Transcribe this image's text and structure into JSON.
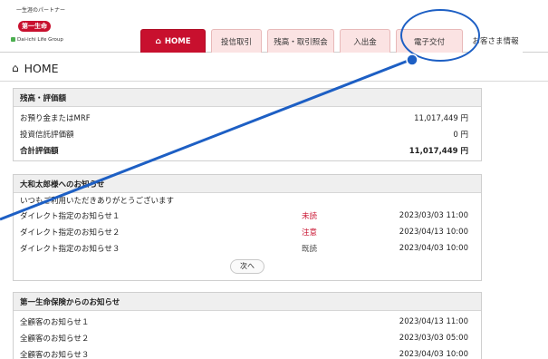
{
  "logo": {
    "tagline": "一生涯のパートナー",
    "brand": "第一生命",
    "group": "Dai-ichi Life Group"
  },
  "tabs": [
    {
      "label": "HOME",
      "icon": "home-icon",
      "active": true
    },
    {
      "label": "投信取引"
    },
    {
      "label": "残高・取引照会"
    },
    {
      "label": "入出金"
    },
    {
      "label": "電子交付"
    },
    {
      "label": "お客さま情報"
    }
  ],
  "page": {
    "title": "HOME",
    "icon": "home-icon"
  },
  "balance": {
    "heading": "残高・評価額",
    "rows": [
      {
        "label": "お預り金またはMRF",
        "value": "11,017,449 円",
        "bold": false
      },
      {
        "label": "投資信託評価額",
        "value": "0 円",
        "bold": false
      },
      {
        "label": "合計評価額",
        "value": "11,017,449 円",
        "bold": true
      }
    ]
  },
  "notices": {
    "heading": "大和太郎様へのお知らせ",
    "intro": "いつもご利用いただきありがとうございます",
    "items": [
      {
        "title": "ダイレクト指定のお知らせ１",
        "status": "未読",
        "date": "2023/03/03 11:00"
      },
      {
        "title": "ダイレクト指定のお知らせ２",
        "status": "注意",
        "date": "2023/04/13 10:00"
      },
      {
        "title": "ダイレクト指定のお知らせ３",
        "status": "既読",
        "date": "2023/04/03 10:00"
      }
    ],
    "next_label": "次へ"
  },
  "company_notices": {
    "heading": "第一生命保険からのお知らせ",
    "items": [
      {
        "title": "全顧客のお知らせ１",
        "date": "2023/04/13 11:00"
      },
      {
        "title": "全顧客のお知らせ２",
        "date": "2023/03/03 05:00"
      },
      {
        "title": "全顧客のお知らせ３",
        "date": "2023/04/03 10:00"
      }
    ]
  },
  "colors": {
    "accent": "#c8102e",
    "annotation": "#1d5fc4"
  }
}
